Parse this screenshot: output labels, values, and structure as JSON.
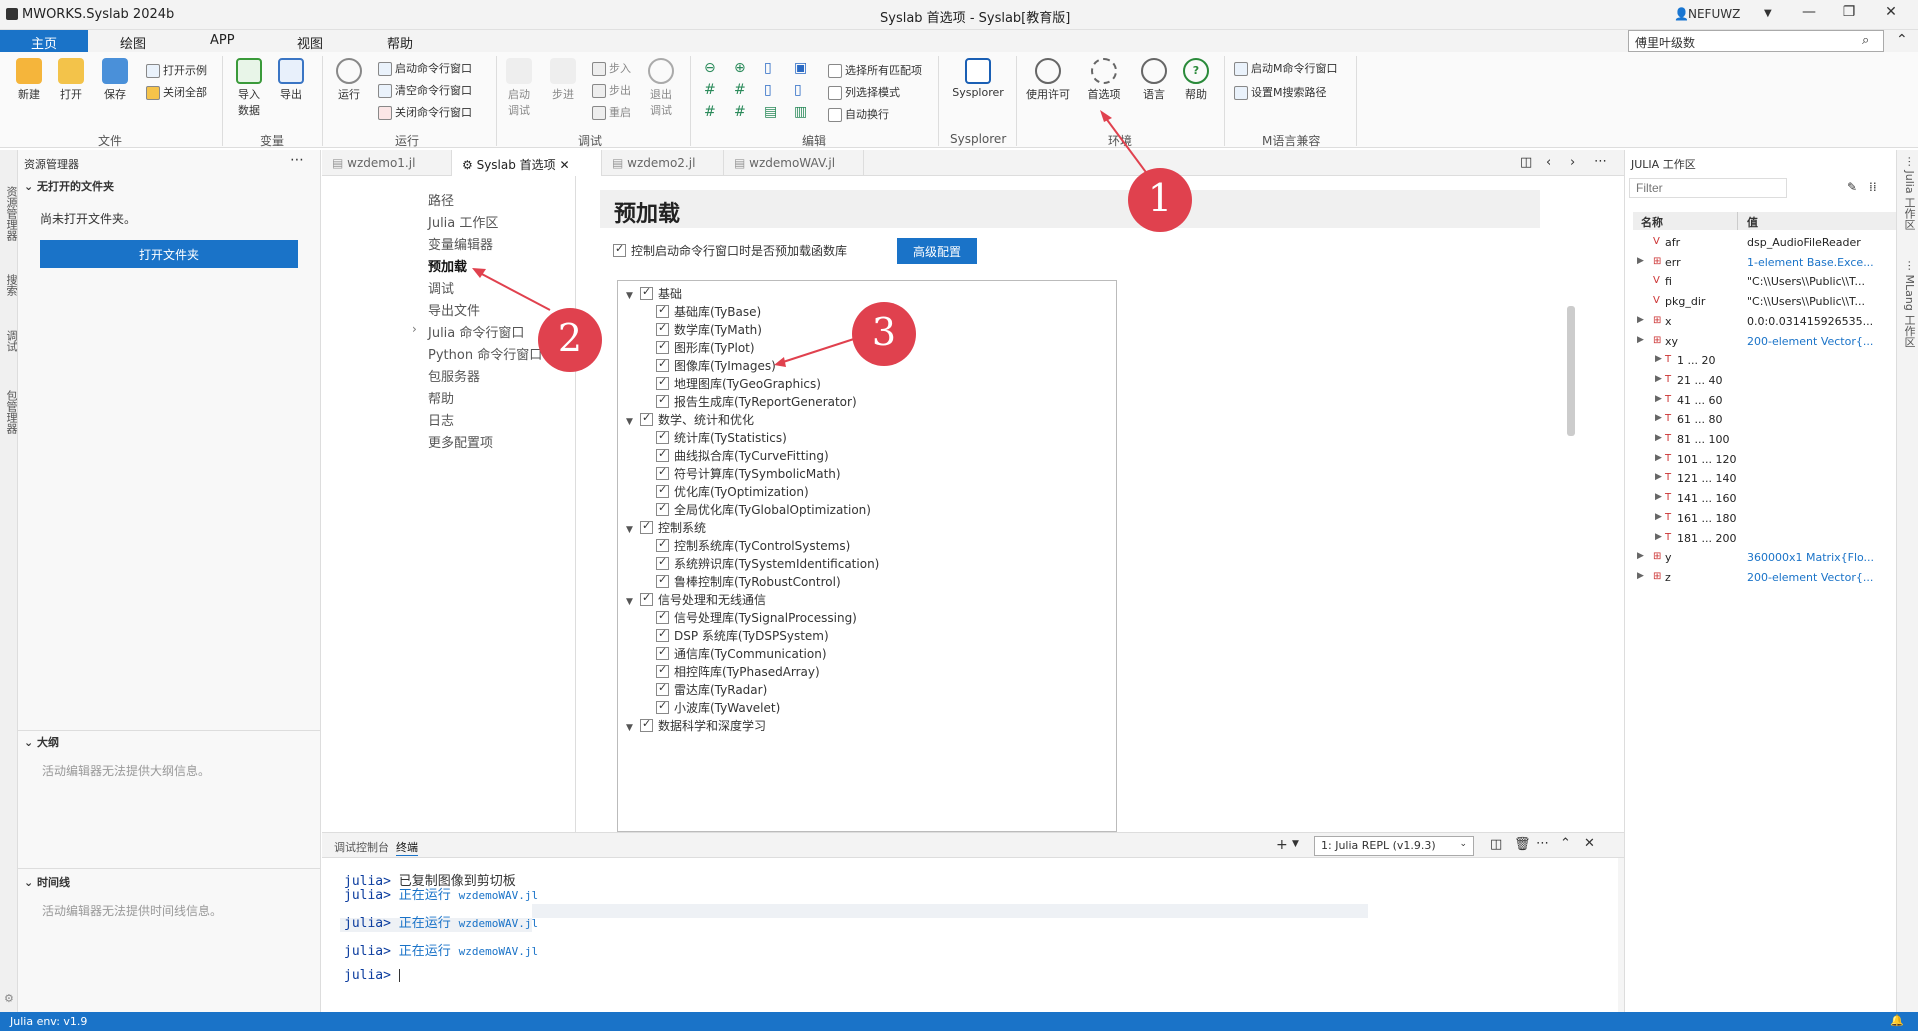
{
  "window": {
    "app_title": "MWORKS.Syslab 2024b",
    "title": "Syslab 首选项 - Syslab[教育版]",
    "user": "NEFUWZ",
    "min": "—",
    "restore": "❐",
    "close": "✕"
  },
  "menu": {
    "items": [
      "主页",
      "绘图",
      "APP",
      "视图",
      "帮助"
    ]
  },
  "search": {
    "value": "傅里叶级数"
  },
  "ribbon": {
    "file": {
      "new": "新建",
      "open": "打开",
      "save": "保存",
      "open_example": "打开示例",
      "close_all": "关闭全部",
      "label": "文件"
    },
    "variable": {
      "import": "导入\n数据",
      "export": "导出",
      "label": "变量"
    },
    "run": {
      "run": "运行",
      "start_cmd": "启动命令行窗口",
      "clear_cmd": "清空命令行窗口",
      "close_cmd": "关闭命令行窗口",
      "label": "运行"
    },
    "debug": {
      "start": "启动\n调试",
      "step": "步进",
      "step_in": "步入",
      "step_out": "步出",
      "restart": "重启",
      "exit": "退出\n调试",
      "label": "调试"
    },
    "edit": {
      "select_all_match": "选择所有匹配项",
      "column_select": "列选择模式",
      "auto_wrap": "自动换行",
      "label": "编辑"
    },
    "sysplorer": {
      "btn": "Sysplorer",
      "label": "Sysplorer"
    },
    "env": {
      "license": "使用许可",
      "preferences": "首选项",
      "language": "语言",
      "help": "帮助",
      "label": "环境"
    },
    "mlang": {
      "start_m": "启动M命令行窗口",
      "set_m_path": "设置M搜索路径",
      "label": "M语言兼容"
    }
  },
  "explorer": {
    "title": "资源管理器",
    "no_folder_header": "无打开的文件夹",
    "no_folder_text": "尚未打开文件夹。",
    "open_folder": "打开文件夹",
    "outline_header": "大纲",
    "outline_text": "活动编辑器无法提供大纲信息。",
    "timeline_header": "时间线",
    "timeline_text": "活动编辑器无法提供时间线信息。"
  },
  "left_vertical": [
    "资源管理器",
    "搜索",
    "调试",
    "包管理器"
  ],
  "editor_tabs": [
    "wzdemo1.jl",
    "Syslab 首选项",
    "wzdemo2.jl",
    "wzdemoWAV.jl"
  ],
  "pref_nav": [
    "路径",
    "Julia 工作区",
    "变量编辑器",
    "预加载",
    "调试",
    "导出文件",
    "Julia 命令行窗口",
    "Python 命令行窗口",
    "包服务器",
    "帮助",
    "日志",
    "更多配置项"
  ],
  "pref": {
    "title": "预加载",
    "control_label": "控制启动命令行窗口时是否预加载函数库",
    "advanced": "高级配置",
    "tree": [
      {
        "group": "基础",
        "items": [
          "基础库(TyBase)",
          "数学库(TyMath)",
          "图形库(TyPlot)",
          "图像库(TyImages)",
          "地理图库(TyGeoGraphics)",
          "报告生成库(TyReportGenerator)"
        ]
      },
      {
        "group": "数学、统计和优化",
        "items": [
          "统计库(TyStatistics)",
          "曲线拟合库(TyCurveFitting)",
          "符号计算库(TySymbolicMath)",
          "优化库(TyOptimization)",
          "全局优化库(TyGlobalOptimization)"
        ]
      },
      {
        "group": "控制系统",
        "items": [
          "控制系统库(TyControlSystems)",
          "系统辨识库(TySystemIdentification)",
          "鲁棒控制库(TyRobustControl)"
        ]
      },
      {
        "group": "信号处理和无线通信",
        "items": [
          "信号处理库(TySignalProcessing)",
          "DSP 系统库(TyDSPSystem)",
          "通信库(TyCommunication)",
          "相控阵库(TyPhasedArray)",
          "雷达库(TyRadar)",
          "小波库(TyWavelet)"
        ]
      },
      {
        "group": "数据科学和深度学习",
        "items": []
      }
    ]
  },
  "bottom": {
    "tabs": [
      "调试控制台",
      "终端"
    ],
    "repl": "1: Julia REPL (v1.9.3)",
    "lines": [
      {
        "prompt": "julia>",
        "text": "已复制图像到剪切板",
        "cmd": ""
      },
      {
        "prompt": "julia>",
        "text": "正在运行",
        "cmd": "wzdemoWAV.jl"
      },
      {
        "prompt": "julia>",
        "text": "正在运行",
        "cmd": "wzdemoWAV.jl"
      },
      {
        "prompt": "julia>",
        "text": "正在运行",
        "cmd": "wzdemoWAV.jl"
      },
      {
        "prompt": "julia>",
        "text": "",
        "cmd": ""
      }
    ]
  },
  "workspace": {
    "title": "JULIA 工作区",
    "filter_placeholder": "Filter",
    "col_name": "名称",
    "col_value": "值",
    "rows": [
      {
        "name": "afr",
        "value": "dsp_AudioFileReader",
        "link": false,
        "type": "V"
      },
      {
        "name": "err",
        "value": "1-element Base.Exce...",
        "link": true,
        "type": "M"
      },
      {
        "name": "fi",
        "value": "\"C:\\\\Users\\\\Public\\\\T...",
        "link": false,
        "type": "V"
      },
      {
        "name": "pkg_dir",
        "value": "\"C:\\\\Users\\\\Public\\\\T...",
        "link": false,
        "type": "V"
      },
      {
        "name": "x",
        "value": "0.0:0.031415926535...",
        "link": false,
        "type": "M"
      },
      {
        "name": "xy",
        "value": "200-element Vector{...",
        "link": true,
        "type": "M"
      },
      {
        "name": "1 ... 20",
        "value": "",
        "link": false,
        "type": "T"
      },
      {
        "name": "21 ... 40",
        "value": "",
        "link": false,
        "type": "T"
      },
      {
        "name": "41 ... 60",
        "value": "",
        "link": false,
        "type": "T"
      },
      {
        "name": "61 ... 80",
        "value": "",
        "link": false,
        "type": "T"
      },
      {
        "name": "81 ... 100",
        "value": "",
        "link": false,
        "type": "T"
      },
      {
        "name": "101 ... 120",
        "value": "",
        "link": false,
        "type": "T"
      },
      {
        "name": "121 ... 140",
        "value": "",
        "link": false,
        "type": "T"
      },
      {
        "name": "141 ... 160",
        "value": "",
        "link": false,
        "type": "T"
      },
      {
        "name": "161 ... 180",
        "value": "",
        "link": false,
        "type": "T"
      },
      {
        "name": "181 ... 200",
        "value": "",
        "link": false,
        "type": "T"
      },
      {
        "name": "y",
        "value": "360000x1 Matrix{Flo...",
        "link": true,
        "type": "M"
      },
      {
        "name": "z",
        "value": "200-element Vector{...",
        "link": true,
        "type": "M"
      }
    ]
  },
  "right_vertical": [
    "Julia 工作区",
    "MLang 工作区"
  ],
  "status": {
    "env": "Julia env: v1.9"
  },
  "annotations": [
    "1",
    "2",
    "3"
  ]
}
